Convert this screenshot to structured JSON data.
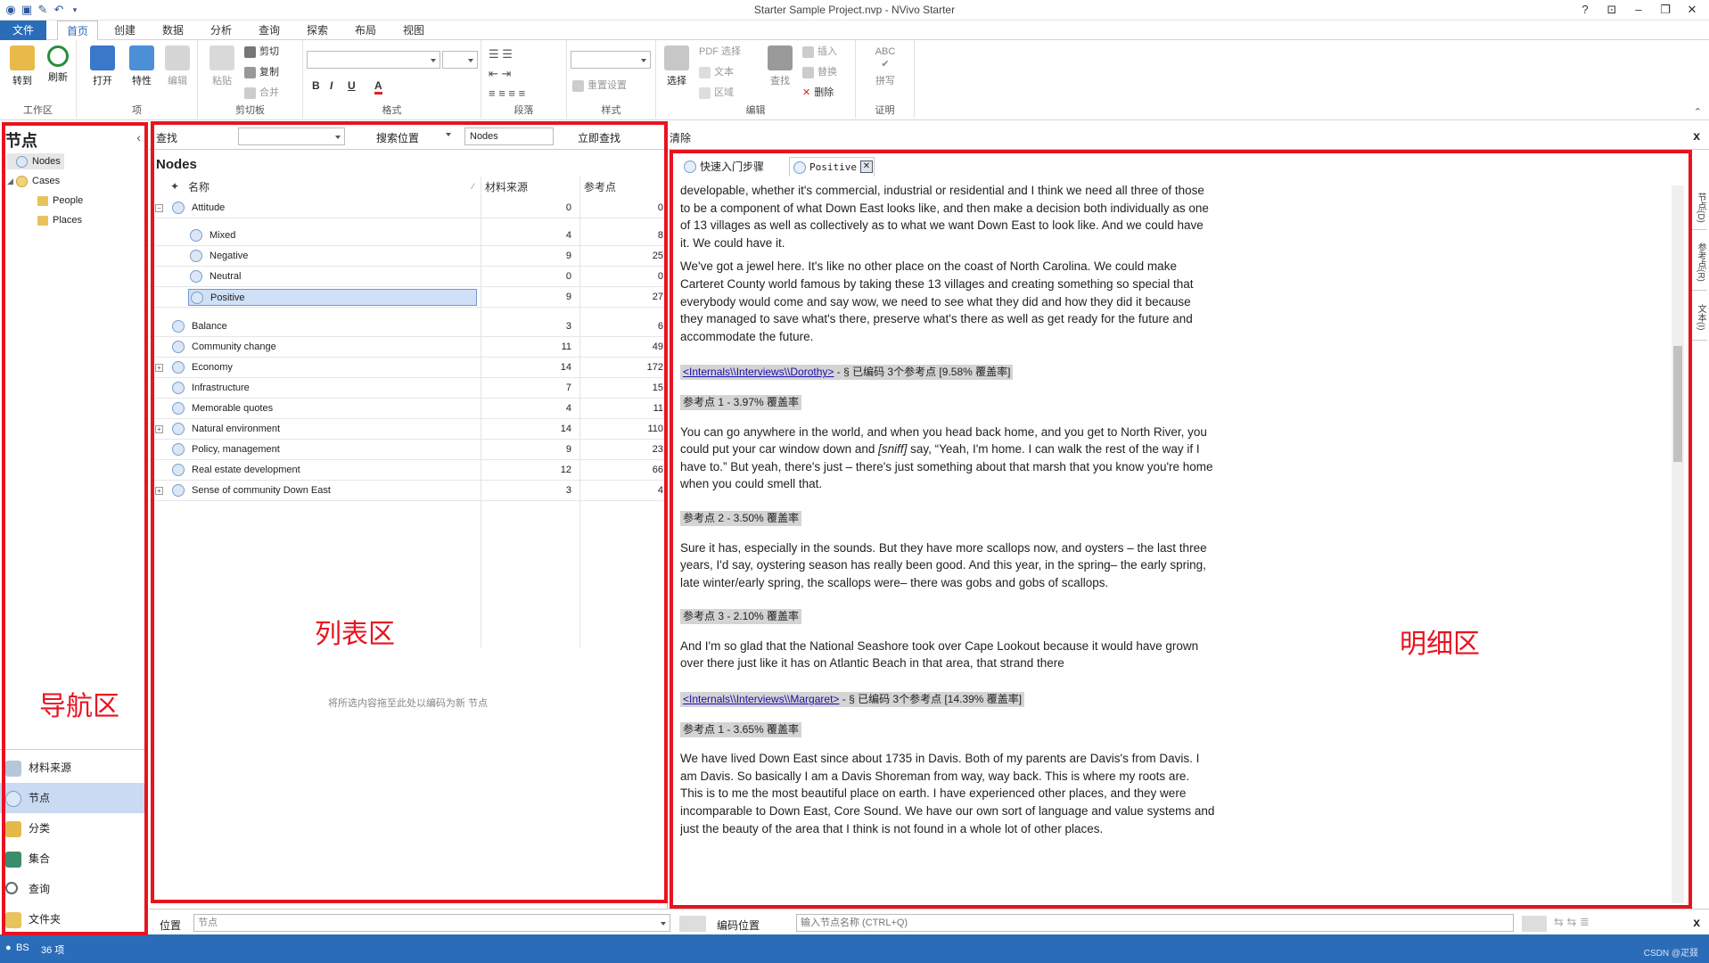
{
  "window": {
    "title": "Starter Sample Project.nvp - NVivo Starter"
  },
  "ribbon": {
    "tabs": [
      "文件",
      "首页",
      "创建",
      "数据",
      "分析",
      "查询",
      "探索",
      "布局",
      "视图"
    ],
    "active_tab": "首页",
    "groups": {
      "workspace": {
        "label": "工作区",
        "goto": "转到",
        "refresh": "刷新"
      },
      "item": {
        "label": "项",
        "open": "打开",
        "properties": "特性",
        "edit": "编辑"
      },
      "clipboard": {
        "label": "剪切板",
        "paste": "粘贴",
        "cut": "剪切",
        "copy": "复制",
        "merge": "合并"
      },
      "format": {
        "label": "格式",
        "bold": "B",
        "italic": "I",
        "underline": "U",
        "fontcolor": "A"
      },
      "paragraph": {
        "label": "段落"
      },
      "styles": {
        "label": "样式",
        "reset": "重置设置"
      },
      "editing": {
        "label": "编辑",
        "select": "选择",
        "pdf_select": "PDF 选择",
        "text": "文本",
        "region": "区域",
        "find": "查找",
        "insert": "插入",
        "replace": "替换",
        "delete": "删除"
      },
      "proofing": {
        "label": "证明",
        "spelling": "拼写",
        "abc": "ABC"
      }
    }
  },
  "nav": {
    "heading": "节点",
    "tree": [
      {
        "label": "Nodes",
        "level": 1
      },
      {
        "label": "Cases",
        "level": 1
      },
      {
        "label": "People",
        "level": 2
      },
      {
        "label": "Places",
        "level": 2
      }
    ],
    "buttons": [
      "材料来源",
      "节点",
      "分类",
      "集合",
      "查询",
      "文件夹"
    ],
    "selected_button": "节点"
  },
  "findbar": {
    "find_label": "查找",
    "search_in_label": "搜索位置",
    "search_in_value": "Nodes",
    "find_now": "立即查找",
    "clear": "清除",
    "close": "x"
  },
  "list": {
    "heading": "Nodes",
    "columns": [
      "名称",
      "材料来源",
      "参考点"
    ],
    "rows": [
      {
        "name": "Attitude",
        "sources": "0",
        "refs": "0",
        "level": 0,
        "expander": "minus"
      },
      {
        "name": "Mixed",
        "sources": "4",
        "refs": "8",
        "level": 1
      },
      {
        "name": "Negative",
        "sources": "9",
        "refs": "25",
        "level": 1
      },
      {
        "name": "Neutral",
        "sources": "0",
        "refs": "0",
        "level": 1
      },
      {
        "name": "Positive",
        "sources": "9",
        "refs": "27",
        "level": 1,
        "selected": true
      },
      {
        "name": "Balance",
        "sources": "3",
        "refs": "6",
        "level": 0
      },
      {
        "name": "Community change",
        "sources": "11",
        "refs": "49",
        "level": 0
      },
      {
        "name": "Economy",
        "sources": "14",
        "refs": "172",
        "level": 0,
        "expander": "plus"
      },
      {
        "name": "Infrastructure",
        "sources": "7",
        "refs": "15",
        "level": 0
      },
      {
        "name": "Memorable quotes",
        "sources": "4",
        "refs": "11",
        "level": 0
      },
      {
        "name": "Natural environment",
        "sources": "14",
        "refs": "110",
        "level": 0,
        "expander": "plus"
      },
      {
        "name": "Policy, management",
        "sources": "9",
        "refs": "23",
        "level": 0
      },
      {
        "name": "Real estate development",
        "sources": "12",
        "refs": "66",
        "level": 0
      },
      {
        "name": "Sense of community Down East",
        "sources": "3",
        "refs": "4",
        "level": 0,
        "expander": "plus"
      }
    ],
    "drop_hint": "将所选内容拖至此处以编码为新 节点"
  },
  "detail": {
    "tabs": [
      "快速入门步骤",
      "Positive"
    ],
    "paragraphs": {
      "p1": "developable, whether it's commercial, industrial or residential and I think we need all three of those to be a component of what Down East looks like, and then make a decision both individually as one of 13 villages as well as collectively as to what we want Down East to look like. And we could have it. We could have it.",
      "p2": "We've got a jewel here. It's like no other place on the coast of North Carolina. We could make Carteret County world famous by taking these 13 villages and creating something so special that everybody would come and say wow, we need to see what they did and how they did it because they managed to save what's there, preserve what's there as well as get ready for the future and accommodate the future.",
      "src1_link": "<Internals\\\\Interviews\\\\Dorothy>",
      "src1_info": " - § 已编码 3个参考点  [9.58% 覆盖率]",
      "ref1": "参考点 1 - 3.97% 覆盖率",
      "p3a": "You can go anywhere in the world, and when you head back home, and you get to North River, you could put your car window down and ",
      "p3b": "[sniff]",
      "p3c": " say, “Yeah, I'm home. I can walk the rest of the way if I have to.” But yeah, there's just – there's just something about that marsh that you know you're home when you could smell that.",
      "ref2": "参考点 2 - 3.50% 覆盖率",
      "p4": "Sure it has, especially in the sounds. But they have more scallops now, and oysters – the last three years, I'd say, oystering season has really been good. And this year, in the spring– the early spring, late winter/early spring, the scallops were– there was gobs and gobs of scallops.",
      "ref3": "参考点 3 - 2.10% 覆盖率",
      "p5": "And I'm so glad that the National Seashore took over Cape Lookout because it would have grown over there just like it has on Atlantic Beach in that area, that strand there",
      "src2_link": "<Internals\\\\Interviews\\\\Margaret>",
      "src2_info": " - § 已编码 3个参考点  [14.39% 覆盖率]",
      "ref4": "参考点 1 - 3.65% 覆盖率",
      "p6": "We have lived Down East since about 1735 in Davis. Both of my parents are Davis's from Davis. I am Davis. So basically I am a Davis Shoreman from way, way back. This is where my roots are. This is to me the most beautiful place on earth. I have experienced other places, and they were incomparable to Down East, Core Sound. We have our own sort of language and value systems and just the beauty of the area that I think is not found in a whole lot of other places."
    },
    "side_tabs": [
      "节点(D)",
      "参考点(R)",
      "文本(I)"
    ]
  },
  "bottombar": {
    "location_label": "位置",
    "location_value": "节点",
    "code_at_label": "编码位置",
    "code_input_placeholder": "输入节点名称 (CTRL+Q)",
    "close": "x"
  },
  "status": {
    "user": "BS",
    "count": "36 项",
    "watermark": "CSDN @疋叕"
  },
  "annotations": {
    "nav_zone": "导航区",
    "list_zone": "列表区",
    "detail_zone": "明细区"
  },
  "colors": {
    "annotation_red": "#e8131f",
    "status_blue": "#2b6cb8",
    "selection": "#cfe0f7"
  }
}
